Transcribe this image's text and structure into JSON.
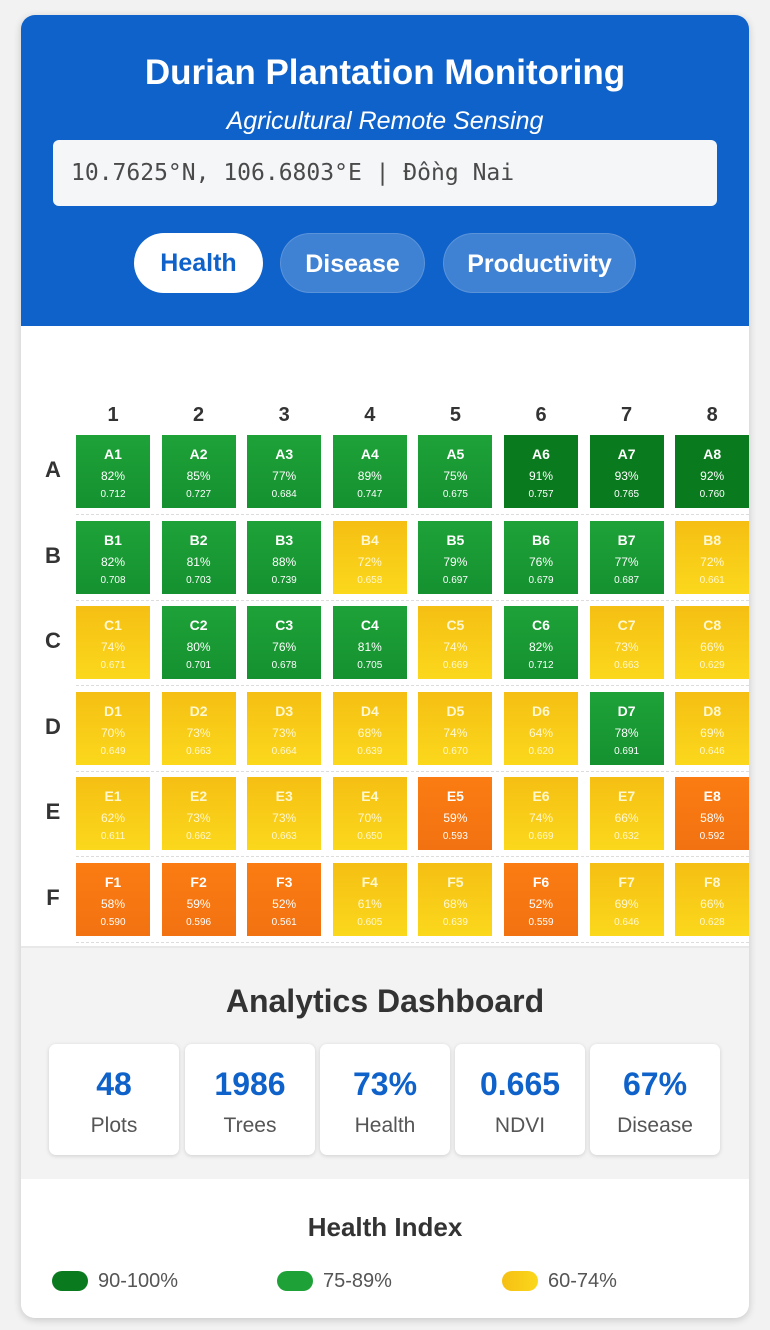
{
  "header": {
    "title": "Durian Plantation Monitoring",
    "subtitle": "Agricultural Remote Sensing",
    "coords": "10.7625°N, 106.6803°E | Đồng Nai",
    "tabs": [
      {
        "label": "Health",
        "active": true
      },
      {
        "label": "Disease",
        "active": false
      },
      {
        "label": "Productivity",
        "active": false
      }
    ]
  },
  "grid": {
    "columns": [
      "1",
      "2",
      "3",
      "4",
      "5",
      "6",
      "7",
      "8"
    ],
    "rows": [
      {
        "label": "A",
        "cells": [
          {
            "id": "A1",
            "health": "82%",
            "ndvi": "0.712",
            "level": "green"
          },
          {
            "id": "A2",
            "health": "85%",
            "ndvi": "0.727",
            "level": "green"
          },
          {
            "id": "A3",
            "health": "77%",
            "ndvi": "0.684",
            "level": "green"
          },
          {
            "id": "A4",
            "health": "89%",
            "ndvi": "0.747",
            "level": "green"
          },
          {
            "id": "A5",
            "health": "75%",
            "ndvi": "0.675",
            "level": "green"
          },
          {
            "id": "A6",
            "health": "91%",
            "ndvi": "0.757",
            "level": "dark"
          },
          {
            "id": "A7",
            "health": "93%",
            "ndvi": "0.765",
            "level": "dark"
          },
          {
            "id": "A8",
            "health": "92%",
            "ndvi": "0.760",
            "level": "dark"
          }
        ]
      },
      {
        "label": "B",
        "cells": [
          {
            "id": "B1",
            "health": "82%",
            "ndvi": "0.708",
            "level": "green"
          },
          {
            "id": "B2",
            "health": "81%",
            "ndvi": "0.703",
            "level": "green"
          },
          {
            "id": "B3",
            "health": "88%",
            "ndvi": "0.739",
            "level": "green"
          },
          {
            "id": "B4",
            "health": "72%",
            "ndvi": "0.658",
            "level": "yellow"
          },
          {
            "id": "B5",
            "health": "79%",
            "ndvi": "0.697",
            "level": "green"
          },
          {
            "id": "B6",
            "health": "76%",
            "ndvi": "0.679",
            "level": "green"
          },
          {
            "id": "B7",
            "health": "77%",
            "ndvi": "0.687",
            "level": "green"
          },
          {
            "id": "B8",
            "health": "72%",
            "ndvi": "0.661",
            "level": "yellow"
          }
        ]
      },
      {
        "label": "C",
        "cells": [
          {
            "id": "C1",
            "health": "74%",
            "ndvi": "0.671",
            "level": "yellow"
          },
          {
            "id": "C2",
            "health": "80%",
            "ndvi": "0.701",
            "level": "green"
          },
          {
            "id": "C3",
            "health": "76%",
            "ndvi": "0.678",
            "level": "green"
          },
          {
            "id": "C4",
            "health": "81%",
            "ndvi": "0.705",
            "level": "green"
          },
          {
            "id": "C5",
            "health": "74%",
            "ndvi": "0.669",
            "level": "yellow"
          },
          {
            "id": "C6",
            "health": "82%",
            "ndvi": "0.712",
            "level": "green"
          },
          {
            "id": "C7",
            "health": "73%",
            "ndvi": "0.663",
            "level": "yellow"
          },
          {
            "id": "C8",
            "health": "66%",
            "ndvi": "0.629",
            "level": "yellow"
          }
        ]
      },
      {
        "label": "D",
        "cells": [
          {
            "id": "D1",
            "health": "70%",
            "ndvi": "0.649",
            "level": "yellow"
          },
          {
            "id": "D2",
            "health": "73%",
            "ndvi": "0.663",
            "level": "yellow"
          },
          {
            "id": "D3",
            "health": "73%",
            "ndvi": "0.664",
            "level": "yellow"
          },
          {
            "id": "D4",
            "health": "68%",
            "ndvi": "0.639",
            "level": "yellow"
          },
          {
            "id": "D5",
            "health": "74%",
            "ndvi": "0.670",
            "level": "yellow"
          },
          {
            "id": "D6",
            "health": "64%",
            "ndvi": "0.620",
            "level": "yellow"
          },
          {
            "id": "D7",
            "health": "78%",
            "ndvi": "0.691",
            "level": "green"
          },
          {
            "id": "D8",
            "health": "69%",
            "ndvi": "0.646",
            "level": "yellow"
          }
        ]
      },
      {
        "label": "E",
        "cells": [
          {
            "id": "E1",
            "health": "62%",
            "ndvi": "0.611",
            "level": "yellow"
          },
          {
            "id": "E2",
            "health": "73%",
            "ndvi": "0.662",
            "level": "yellow"
          },
          {
            "id": "E3",
            "health": "73%",
            "ndvi": "0.663",
            "level": "yellow"
          },
          {
            "id": "E4",
            "health": "70%",
            "ndvi": "0.650",
            "level": "yellow"
          },
          {
            "id": "E5",
            "health": "59%",
            "ndvi": "0.593",
            "level": "orange"
          },
          {
            "id": "E6",
            "health": "74%",
            "ndvi": "0.669",
            "level": "yellow"
          },
          {
            "id": "E7",
            "health": "66%",
            "ndvi": "0.632",
            "level": "yellow"
          },
          {
            "id": "E8",
            "health": "58%",
            "ndvi": "0.592",
            "level": "orange"
          }
        ]
      },
      {
        "label": "F",
        "cells": [
          {
            "id": "F1",
            "health": "58%",
            "ndvi": "0.590",
            "level": "orange"
          },
          {
            "id": "F2",
            "health": "59%",
            "ndvi": "0.596",
            "level": "orange"
          },
          {
            "id": "F3",
            "health": "52%",
            "ndvi": "0.561",
            "level": "orange"
          },
          {
            "id": "F4",
            "health": "61%",
            "ndvi": "0.605",
            "level": "yellow"
          },
          {
            "id": "F5",
            "health": "68%",
            "ndvi": "0.639",
            "level": "yellow"
          },
          {
            "id": "F6",
            "health": "52%",
            "ndvi": "0.559",
            "level": "orange"
          },
          {
            "id": "F7",
            "health": "69%",
            "ndvi": "0.646",
            "level": "yellow"
          },
          {
            "id": "F8",
            "health": "66%",
            "ndvi": "0.628",
            "level": "yellow"
          }
        ]
      }
    ]
  },
  "dashboard": {
    "title": "Analytics Dashboard",
    "stats": [
      {
        "value": "48",
        "label": "Plots"
      },
      {
        "value": "1986",
        "label": "Trees"
      },
      {
        "value": "73%",
        "label": "Health"
      },
      {
        "value": "0.665",
        "label": "NDVI"
      },
      {
        "value": "67%",
        "label": "Disease"
      }
    ]
  },
  "legend": {
    "title": "Health Index",
    "items": [
      {
        "label": "90-100%",
        "color": "#0a7a1e"
      },
      {
        "label": "75-89%",
        "color": "#1ea238"
      },
      {
        "label": "60-74%",
        "color": "#f8c916"
      }
    ]
  },
  "colors": {
    "primary": "#0f62c9",
    "dark_green": "#0a7a1e",
    "green": "#1ea238",
    "yellow": "#f8c916",
    "orange": "#fb7c12"
  }
}
